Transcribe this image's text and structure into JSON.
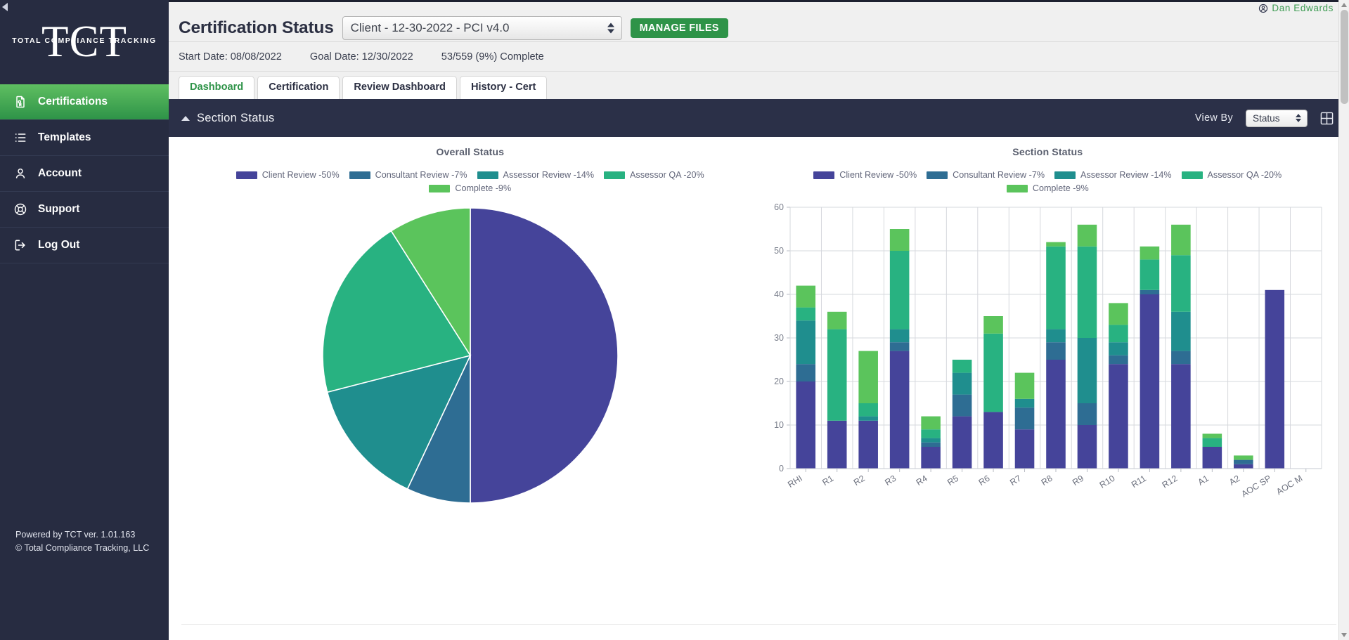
{
  "colors": {
    "sidebar_bg": "#272c41",
    "accent_green": "#2e9348",
    "panel_head_bg": "#2b3048",
    "client_review": "#45449a",
    "consultant_review": "#2e6d93",
    "assessor_review": "#1f8e8e",
    "assessor_qa": "#28b281",
    "complete": "#5bc45c"
  },
  "sidebar": {
    "logo_text": "TCT",
    "logo_subtext": "TOTAL COMPLIANCE TRACKING",
    "items": [
      {
        "label": "Certifications",
        "icon": "certificate-icon",
        "active": true
      },
      {
        "label": "Templates",
        "icon": "list-icon",
        "active": false
      },
      {
        "label": "Account",
        "icon": "user-icon",
        "active": false
      },
      {
        "label": "Support",
        "icon": "lifebuoy-icon",
        "active": false
      },
      {
        "label": "Log Out",
        "icon": "logout-icon",
        "active": false
      }
    ],
    "footer_line1": "Powered by TCT ver. 1.01.163",
    "footer_line2": "© Total Compliance Tracking, LLC"
  },
  "header": {
    "user_name": "Dan Edwards",
    "page_title": "Certification Status",
    "cert_selected": "Client - 12-30-2022 - PCI v4.0",
    "manage_files_label": "MANAGE FILES",
    "start_date": "Start Date: 08/08/2022",
    "goal_date": "Goal Date: 12/30/2022",
    "complete_status": "53/559 (9%) Complete"
  },
  "tabs": [
    {
      "label": "Dashboard",
      "active": true
    },
    {
      "label": "Certification",
      "active": false
    },
    {
      "label": "Review Dashboard",
      "active": false
    },
    {
      "label": "History - Cert",
      "active": false
    }
  ],
  "panel": {
    "title": "Section Status",
    "view_by_label": "View By",
    "view_by_value": "Status"
  },
  "chart_data": [
    {
      "type": "pie",
      "title": "Overall Status",
      "legend_position": "top",
      "labels": [
        "Client Review -50%",
        "Consultant Review -7%",
        "Assessor Review -14%",
        "Assessor QA -20%",
        "Complete -9%"
      ],
      "values": [
        50,
        7,
        14,
        20,
        9
      ],
      "colors": [
        "#45449a",
        "#2e6d93",
        "#1f8e8e",
        "#28b281",
        "#5bc45c"
      ]
    },
    {
      "type": "bar",
      "title": "Section Status",
      "stacked": true,
      "legend_position": "top",
      "xlabel": "",
      "ylabel": "",
      "ylim": [
        0,
        60
      ],
      "yticks": [
        0,
        10,
        20,
        30,
        40,
        50,
        60
      ],
      "grid": true,
      "categories": [
        "RHI",
        "R1",
        "R2",
        "R3",
        "R4",
        "R5",
        "R6",
        "R7",
        "R8",
        "R9",
        "R10",
        "R11",
        "R12",
        "A1",
        "A2",
        "AOC SP",
        "AOC M"
      ],
      "series": [
        {
          "name": "Client Review -50%",
          "color": "#45449a",
          "values": [
            20,
            11,
            11,
            27,
            5,
            12,
            13,
            9,
            25,
            10,
            24,
            40,
            24,
            5,
            1,
            41,
            0
          ]
        },
        {
          "name": "Consultant Review -7%",
          "color": "#2e6d93",
          "values": [
            4,
            0,
            0,
            2,
            1,
            5,
            0,
            5,
            4,
            5,
            2,
            1,
            3,
            0,
            1,
            0,
            0
          ]
        },
        {
          "name": "Assessor Review -14%",
          "color": "#1f8e8e",
          "values": [
            10,
            0,
            1,
            3,
            1,
            5,
            0,
            2,
            3,
            15,
            3,
            0,
            9,
            0,
            0,
            0,
            0
          ]
        },
        {
          "name": "Assessor QA -20%",
          "color": "#28b281",
          "values": [
            3,
            21,
            3,
            18,
            2,
            3,
            18,
            0,
            19,
            21,
            4,
            7,
            13,
            2,
            0,
            0,
            0
          ]
        },
        {
          "name": "Complete -9%",
          "color": "#5bc45c",
          "values": [
            5,
            4,
            12,
            5,
            3,
            0,
            4,
            6,
            1,
            5,
            5,
            3,
            7,
            1,
            1,
            0,
            0
          ]
        }
      ]
    }
  ]
}
